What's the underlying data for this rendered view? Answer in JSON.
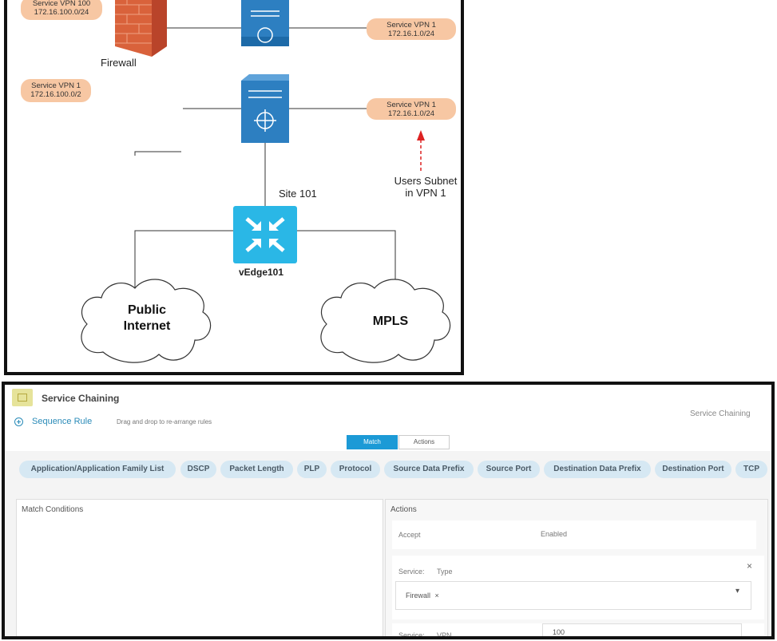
{
  "diagram": {
    "pill_top_left": [
      "Service VPN 100",
      "172.16.100.0/24"
    ],
    "pill_top_right": [
      "Service VPN 1",
      "172.16.1.0/24"
    ],
    "pill_mid_left": [
      "Service VPN 1",
      "172.16.100.0/2"
    ],
    "pill_mid_right": [
      "Service VPN 1",
      "172.16.1.0/24"
    ],
    "firewall_label": "Firewall",
    "site_label": "Site 101",
    "users_label_1": "Users Subnet",
    "users_label_2": "in VPN 1",
    "vedge_label": "vEdge101",
    "cloud_internet_1": "Public",
    "cloud_internet_2": "Internet",
    "cloud_mpls": "MPLS"
  },
  "service": {
    "title": "Service Chaining",
    "sequence_rule": "Sequence Rule",
    "drag_hint": "Drag and drop to re-arrange rules",
    "right_title": "Service Chaining",
    "tab_match": "Match",
    "tab_actions": "Actions",
    "chips": [
      "Application/Application Family List",
      "DSCP",
      "Packet Length",
      "PLP",
      "Protocol",
      "Source Data Prefix",
      "Source Port",
      "Destination Data Prefix",
      "Destination Port",
      "TCP"
    ],
    "match_conditions": "Match Conditions",
    "actions": "Actions",
    "accept_label": "Accept",
    "accept_value": "Enabled",
    "service_label": "Service:",
    "type_label": "Type",
    "close": "×",
    "firewall_tag": "Firewall",
    "tag_remove": "×",
    "dropdown_arrow": "▾",
    "vpn_service_label": "Service:",
    "vpn_label": "VPN",
    "vpn_value": "100"
  }
}
